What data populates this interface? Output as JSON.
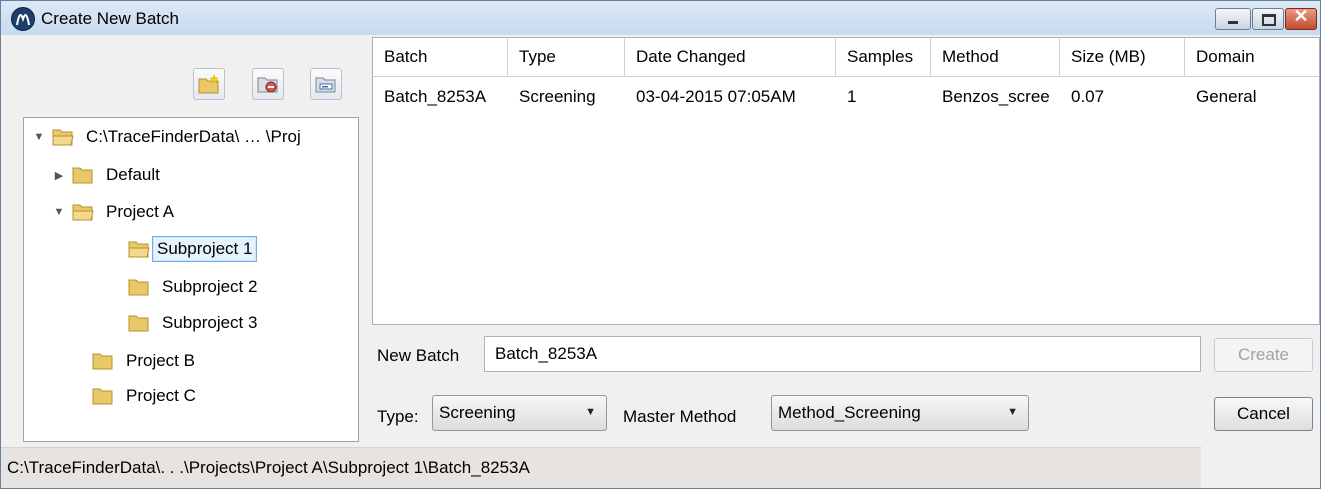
{
  "window": {
    "title": "Create New Batch",
    "controls": [
      "minimize-icon",
      "maximize-icon",
      "close-icon"
    ]
  },
  "toolbar": {
    "icons": [
      "new-folder-icon",
      "delete-folder-icon",
      "rename-folder-icon"
    ]
  },
  "tree": {
    "root": {
      "label": "C:\\TraceFinderData\\ … \\Proj",
      "expanded": true
    },
    "items": [
      {
        "label": "Default",
        "level": 1,
        "arrow": "collapsed"
      },
      {
        "label": "Project A",
        "level": 1,
        "arrow": "expanded"
      },
      {
        "label": "Subproject 1",
        "level": 2,
        "selected": true
      },
      {
        "label": "Subproject 2",
        "level": 2
      },
      {
        "label": "Subproject 3",
        "level": 2
      },
      {
        "label": "Project B",
        "level": 1
      },
      {
        "label": "Project C",
        "level": 1
      }
    ]
  },
  "batch_table": {
    "columns": [
      "Batch",
      "Type",
      "Date Changed",
      "Samples",
      "Method",
      "Size (MB)",
      "Domain"
    ],
    "rows": [
      [
        "Batch_8253A",
        "Screening",
        "03-04-2015 07:05AM",
        "1",
        "Benzos_scree",
        "0.07",
        "General"
      ]
    ]
  },
  "form": {
    "new_batch_label": "New Batch",
    "new_batch_value": "Batch_8253A",
    "create_label": "Create",
    "type_label": "Type:",
    "type_value": "Screening",
    "master_method_label": "Master Method",
    "master_method_value": "Method_Screening",
    "cancel_label": "Cancel"
  },
  "status": {
    "path": "C:\\TraceFinderData\\. . .\\Projects\\Project A\\Subproject 1\\Batch_8253A"
  },
  "colors": {
    "folder_fill": "#e9c86a",
    "folder_dark": "#b98f2c",
    "selection_border": "#6fb1e6",
    "close_button": "#c44a2c"
  }
}
